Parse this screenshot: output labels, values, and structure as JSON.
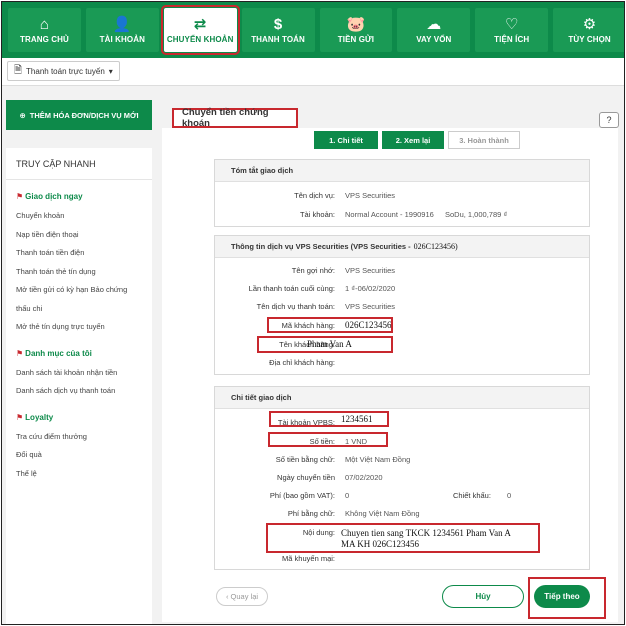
{
  "nav": {
    "items": [
      {
        "label": "TRANG CHỦ",
        "icon": "home-icon",
        "glyph": "⌂"
      },
      {
        "label": "TÀI KHOẢN",
        "icon": "user-icon",
        "glyph": "👤"
      },
      {
        "label": "CHUYỂN KHOẢN",
        "icon": "transfer-icon",
        "glyph": "⇄"
      },
      {
        "label": "THANH TOÁN",
        "icon": "payment-icon",
        "glyph": "$"
      },
      {
        "label": "TIỀN GỬI",
        "icon": "piggy-icon",
        "glyph": "🐷"
      },
      {
        "label": "VAY VỐN",
        "icon": "loan-icon",
        "glyph": "☁"
      },
      {
        "label": "TIỆN ÍCH",
        "icon": "heart-icon",
        "glyph": "♡"
      },
      {
        "label": "TÙY CHỌN",
        "icon": "settings-icon",
        "glyph": "⚙"
      }
    ]
  },
  "toolbar": {
    "dropdown_label": "Thanh toán trực tuyến",
    "caret": "▾",
    "doc_glyph": "🗎"
  },
  "sidebar": {
    "add_button": "THÊM HÓA ĐƠN/DỊCH VỤ MỚI",
    "title": "TRUY CẬP NHANH",
    "sections": [
      {
        "title": "Giao dịch ngay",
        "items": [
          "Chuyển khoản",
          "Nạp tiền điện thoại",
          "Thanh toán tiền điện",
          "Thanh toán thẻ tín dụng",
          "Mở tiền gửi có kỳ hạn Bảo chứng",
          "thấu chi",
          "Mở thẻ tín dụng trực tuyến"
        ]
      },
      {
        "title": "Danh mục của tôi",
        "items": [
          "Danh sách tài khoản nhận tiền",
          "Danh sách dịch vụ thanh toán"
        ]
      },
      {
        "title": "Loyalty",
        "items": [
          "Tra cứu điểm thưởng",
          "Đổi quà",
          "Thể lệ"
        ]
      }
    ]
  },
  "main": {
    "title": "Chuyển tiền chứng khoán",
    "help": "?",
    "steps": [
      "1. Chi tiết",
      "2. Xem lại",
      "3. Hoàn thành"
    ]
  },
  "summary": {
    "header": "Tóm tắt giao dịch",
    "service_label": "Tên dịch vụ:",
    "service_value": "VPS Securities",
    "account_label": "Tài khoản:",
    "account_value": "Normal Account - 1990916",
    "balance_value": "SoDu, 1,000,789 ₫"
  },
  "service_info": {
    "header": "Thông tin dịch vụ VPS Securities (VPS Securities -",
    "header_code": "026C123456)",
    "rows": [
      {
        "label": "Tên gợi nhớ:",
        "value": "VPS Securities"
      },
      {
        "label": "Lần thanh toán cuối cùng:",
        "value": "1 ₫-06/02/2020"
      },
      {
        "label": "Tên dịch vụ thanh toán:",
        "value": "VPS Securities"
      },
      {
        "label": "Mã khách hàng:",
        "value": "026C123456"
      },
      {
        "label": "Tên khách hàng:",
        "value": "Pham Van A"
      },
      {
        "label": "Địa chỉ khách hàng:",
        "value": ""
      }
    ]
  },
  "details": {
    "header": "Chi tiết giao dịch",
    "vpbs_label": "Tài khoản VPBS:",
    "vpbs_value": "1234561",
    "amount_label": "Số tiền:",
    "amount_value": "1 VND",
    "words_label": "Số tiền bằng chữ:",
    "words_value": "Một Việt Nam Đồng",
    "date_label": "Ngày chuyển tiền",
    "date_value": "07/02/2020",
    "fee_label": "Phí (bao gồm VAT):",
    "fee_value": "0",
    "discount_label": "Chiết khấu:",
    "discount_value": "0",
    "fee_words_label": "Phí bằng chữ:",
    "fee_words_value": "Không Việt Nam Đồng",
    "content_label": "Nội dung:",
    "content_line1": "Chuyen tien sang TKCK 1234561 Pham Van A",
    "content_line2": "MA KH 026C123456",
    "promo_label": "Mã khuyến mại:",
    "promo_value": ""
  },
  "buttons": {
    "back": "‹ Quay lại",
    "cancel": "Hủy",
    "next": "Tiếp theo"
  },
  "colors": {
    "brand_green": "#0d8a4a",
    "highlight_red": "#c8282e"
  }
}
